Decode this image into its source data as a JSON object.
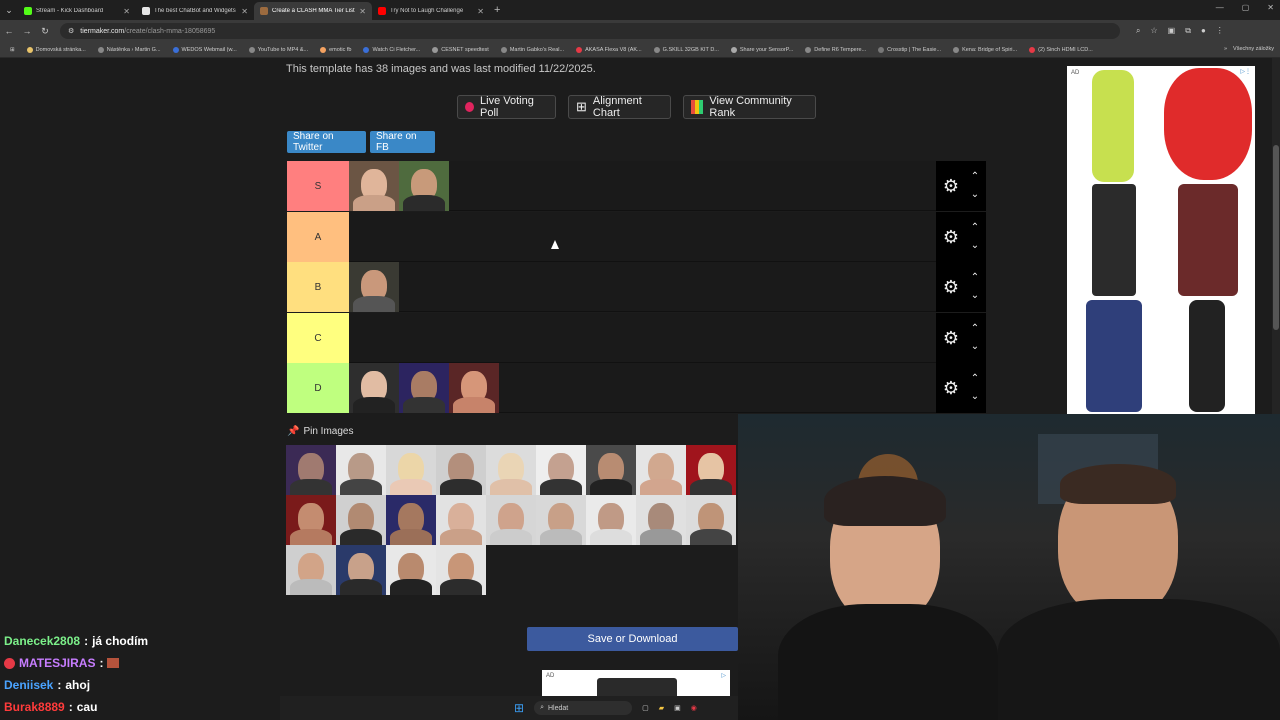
{
  "browser": {
    "tabs": [
      {
        "title": "Stream - Kick Dashboard",
        "color": "#53fc18"
      },
      {
        "title": "The best ChatBot and Widgets",
        "color": "#e6e6e6"
      },
      {
        "title": "Create a CLASH MMA Tier List",
        "color": "#9c6b3f"
      },
      {
        "title": "Try Not to Laugh Challenge",
        "color": "#ff0000"
      }
    ],
    "active_tab": 2,
    "url_domain": "tiermaker.com",
    "url_path": "/create/clash-mma-18058695",
    "bookmarks": [
      "Domovská stránka...",
      "Nástěnka › Martin G...",
      "WEDOS Webmail (w...",
      "YouTube to MP4 &...",
      "emotic fb",
      "Watch Ci Fletcher...",
      "CESNET speedtest",
      "Martin Gabko's Real...",
      "AKASA Flexa V8 (AK...",
      "G.SKILL 32GB KIT D...",
      "Share your SensorP...",
      "Define R6 Tempere...",
      "Crosstip | The Easie...",
      "Kena: Bridge of Spiri...",
      "(2) Sinch HDMI LCD..."
    ],
    "bookmarks_right": "Všechny záložky"
  },
  "page": {
    "template_info": "This template has 38 images and was last modified 11/22/2025.",
    "buttons": {
      "live_voting": "Live Voting Poll",
      "alignment": "Alignment Chart",
      "community": "View Community Rank"
    },
    "share": {
      "twitter": "Share on Twitter",
      "fb": "Share on FB"
    },
    "pin_images": "Pin Images",
    "save": "Save or Download",
    "ad_label": "AD"
  },
  "tiers": [
    {
      "label": "S",
      "color": "#ff7f7f",
      "items": 2
    },
    {
      "label": "A",
      "color": "#ffbf7f",
      "items": 0
    },
    {
      "label": "B",
      "color": "#ffdf7f",
      "items": 1
    },
    {
      "label": "C",
      "color": "#ffff7f",
      "items": 0
    },
    {
      "label": "D",
      "color": "#bfff7f",
      "items": 3
    }
  ],
  "pool_count": 22,
  "chat": [
    {
      "user": "Danecek2808",
      "color": "#7cf08a",
      "text": "já chodím",
      "badge": false
    },
    {
      "user": "MATESJIRAS",
      "color": "#c77dff",
      "text": "",
      "badge": true
    },
    {
      "user": "Deniisek",
      "color": "#4aa3ff",
      "text": "ahoj",
      "badge": false
    },
    {
      "user": "Burak8889",
      "color": "#ff3b3b",
      "text": "cau",
      "badge": false
    }
  ],
  "taskbar": {
    "search": "Hledat"
  }
}
